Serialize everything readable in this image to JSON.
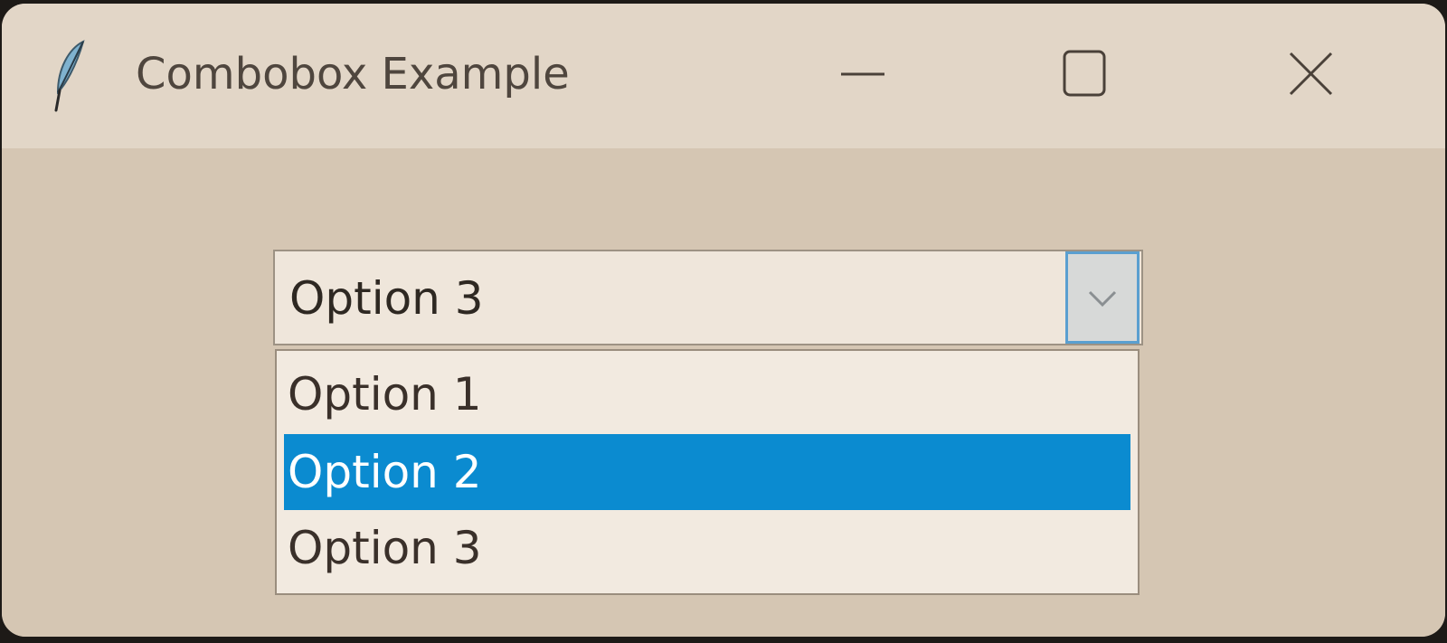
{
  "window": {
    "title": "Combobox Example",
    "icon": "feather-icon",
    "controls": {
      "minimize_icon": "minimize-icon",
      "maximize_icon": "maximize-icon",
      "close_icon": "close-icon"
    }
  },
  "combobox": {
    "selected_value": "Option 3",
    "arrow_icon": "chevron-down-icon",
    "expanded": true,
    "options": [
      {
        "label": "Option 1",
        "highlighted": false
      },
      {
        "label": "Option 2",
        "highlighted": true
      },
      {
        "label": "Option 3",
        "highlighted": false
      }
    ]
  },
  "colors": {
    "highlight": "#0b8bd0",
    "focus_border": "#5a9fd0",
    "window_bg": "#d5c6b3",
    "titlebar_bg": "#e2d6c7"
  }
}
